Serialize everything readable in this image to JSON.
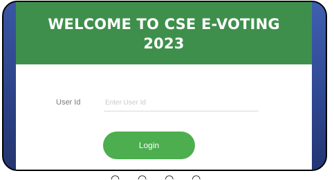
{
  "header": {
    "title_line1": "WELCOME TO CSE E-VOTING",
    "title_line2": "2023"
  },
  "login_form": {
    "user_id_label": "User Id",
    "user_id_placeholder": "Enter User Id",
    "user_id_value": "",
    "login_label": "Login"
  },
  "colors": {
    "header_green": "#3f8f4c",
    "button_green": "#4cae4f",
    "background_blue": "#2b3f86"
  }
}
